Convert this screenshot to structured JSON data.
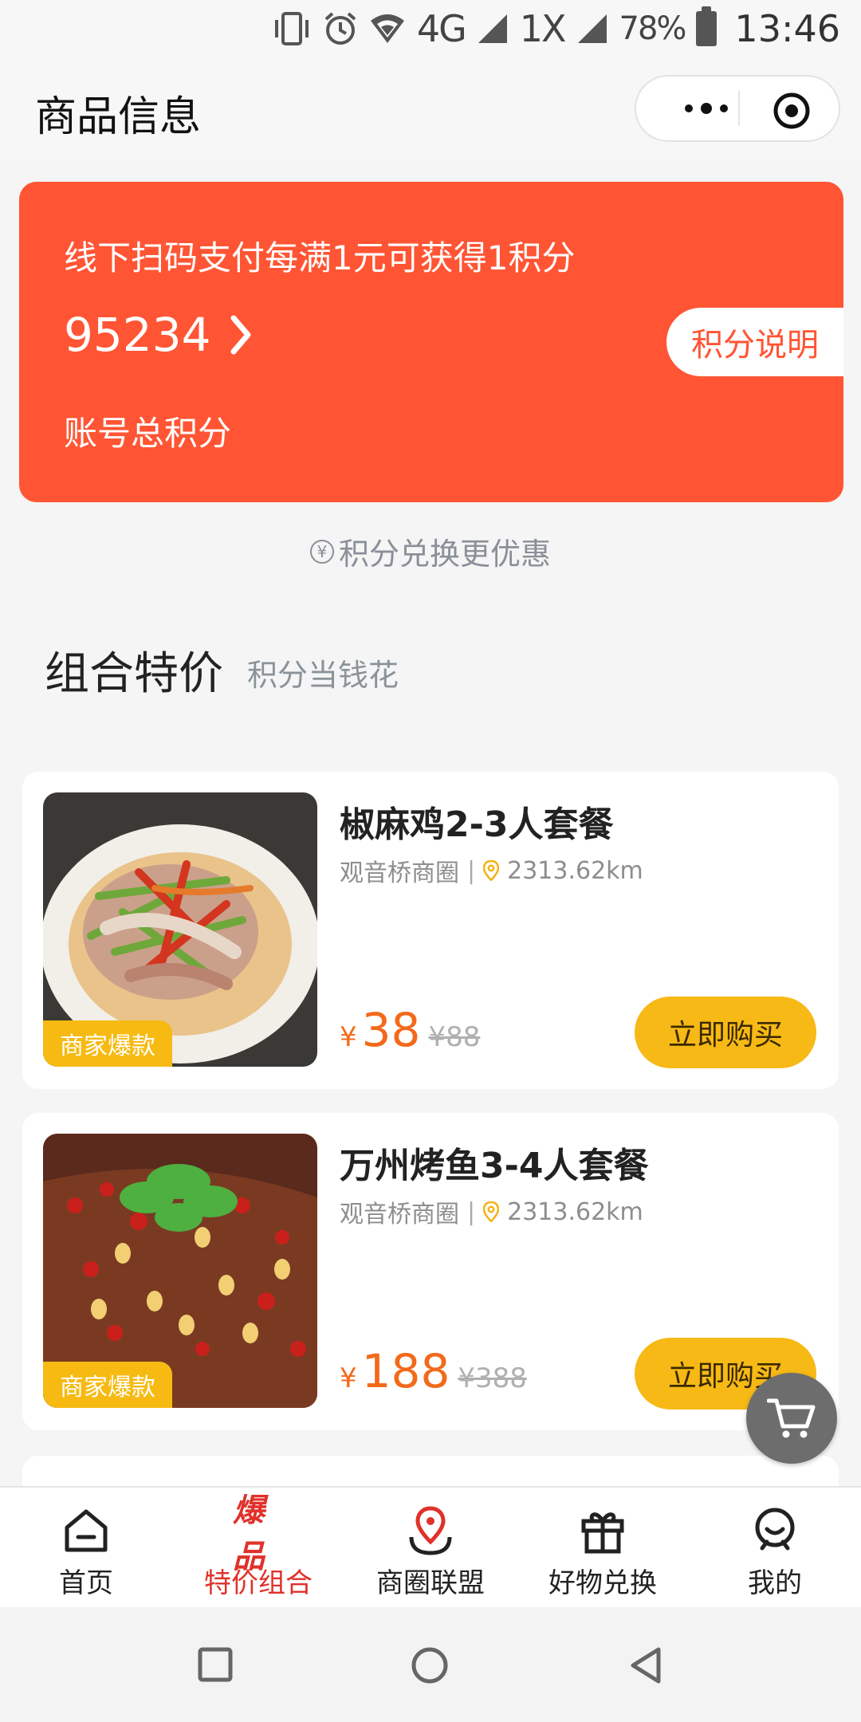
{
  "status": {
    "network": "4G",
    "network2": "1X",
    "battery": "78%",
    "time": "13:46"
  },
  "nav": {
    "title": "商品信息"
  },
  "points": {
    "tip": "线下扫码支付每满1元可获得1积分",
    "value": "95234",
    "label": "账号总积分",
    "explain_button": "积分说明"
  },
  "exchange_tip": "积分兑换更优惠",
  "section": {
    "title": "组合特价",
    "subtitle": "积分当钱花"
  },
  "products": [
    {
      "name": "椒麻鸡2-3人套餐",
      "district": "观音桥商圈",
      "distance": "2313.62km",
      "currency": "¥",
      "price": "38",
      "old_price": "¥88",
      "badge": "商家爆款",
      "buy": "立即购买"
    },
    {
      "name": "万州烤鱼3-4人套餐",
      "district": "观音桥商圈",
      "distance": "2313.62km",
      "currency": "¥",
      "price": "188",
      "old_price": "¥388",
      "badge": "商家爆款",
      "buy": "立即购买"
    }
  ],
  "tabs": [
    {
      "label": "首页",
      "icon": "home-icon"
    },
    {
      "label": "特价组合",
      "icon": "hot-deal-icon",
      "icon_text": "爆品",
      "active": true
    },
    {
      "label": "商圈联盟",
      "icon": "location-pin-icon"
    },
    {
      "label": "好物兑换",
      "icon": "gift-icon"
    },
    {
      "label": "我的",
      "icon": "profile-icon"
    }
  ],
  "colors": {
    "accent": "#ff5534",
    "button": "#f7b916",
    "price": "#f26a1b",
    "active_tab": "#e0312b"
  }
}
